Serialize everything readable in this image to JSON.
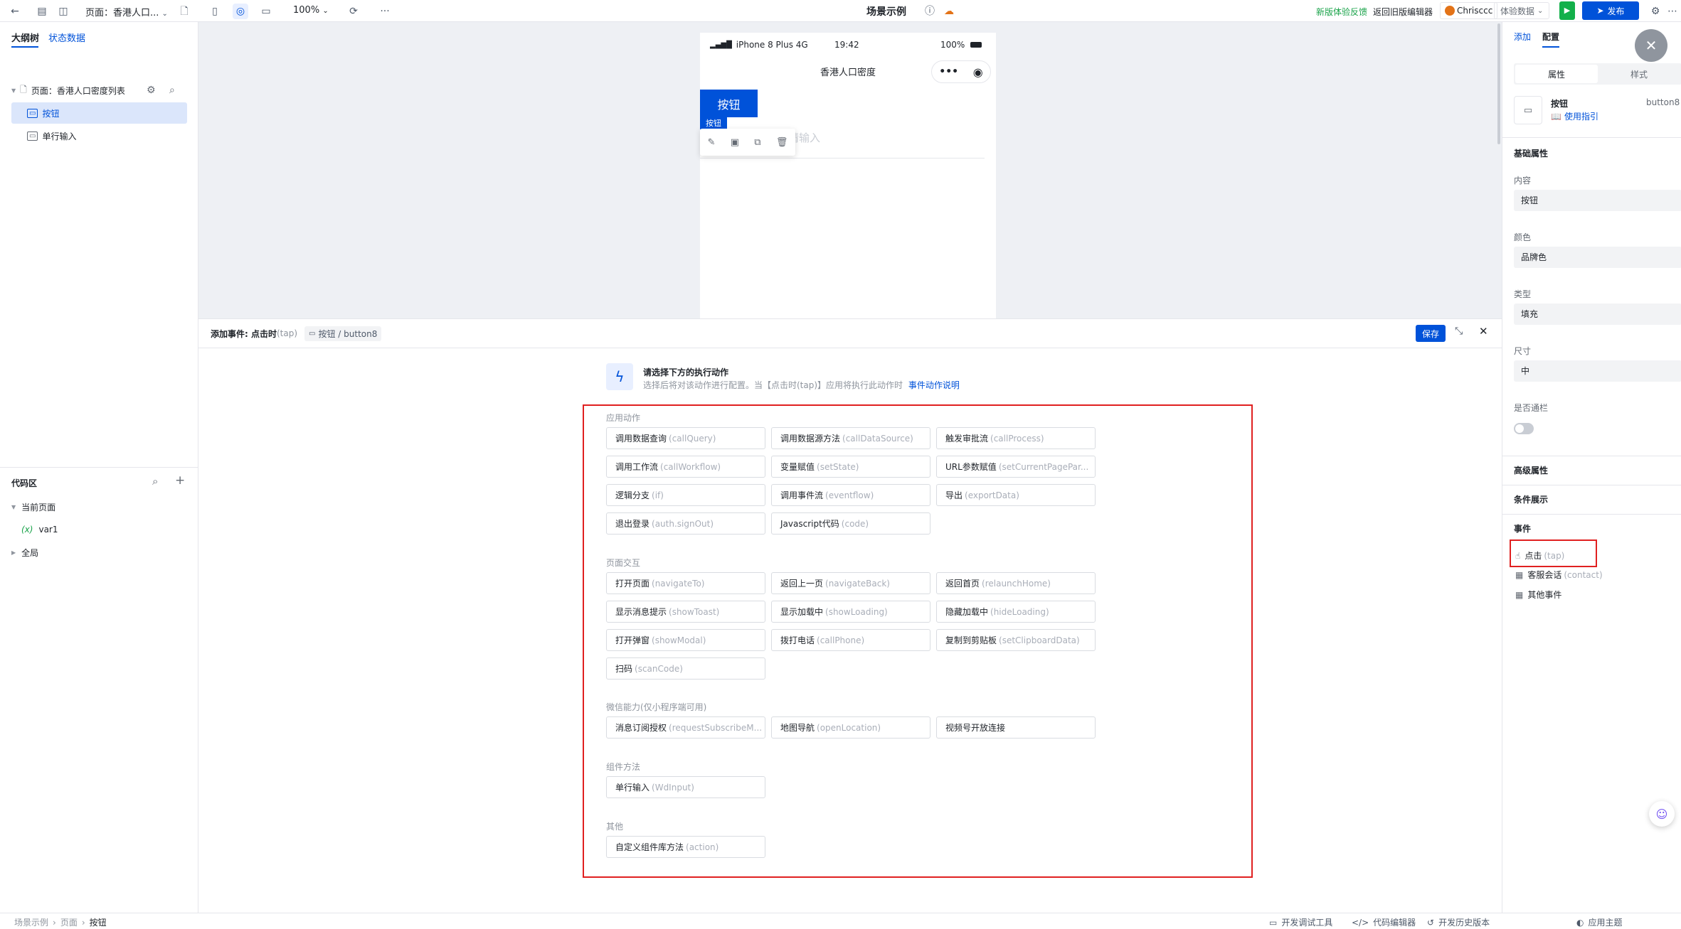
{
  "topbar": {
    "page_select": "页面：香港人口...",
    "zoom": "100%",
    "title": "场景示例",
    "feedback": "新版体验反馈",
    "back_old": "返回旧版编辑器",
    "user": "Chrisccc",
    "env": "体验数据",
    "publish": "发布"
  },
  "left": {
    "tab_outline": "大纲树",
    "tab_state": "状态数据",
    "page_node": "页面：香港人口密度列表",
    "node_button": "按钮",
    "node_input": "单行输入",
    "code_title": "代码区",
    "code_current": "当前页面",
    "code_var": "var1",
    "code_global": "全局"
  },
  "phone": {
    "carrier": "iPhone 8 Plus  4G",
    "time": "19:42",
    "battery": "100%",
    "title": "香港人口密度",
    "button_label": "按钮",
    "selected_tag": "按钮",
    "input_placeholder": "请输入"
  },
  "event": {
    "header_title": "添加事件: 点击时",
    "header_tap": "(tap)",
    "header_target": "按钮 / button8",
    "save": "保存",
    "prompt_title": "请选择下方的执行动作",
    "prompt_desc": "选择后将对该动作进行配置。当【点击时(tap)】应用将执行此动作时",
    "prompt_link": "事件动作说明",
    "sections": [
      {
        "title": "应用动作",
        "items": [
          {
            "cn": "调用数据查询",
            "en": "(callQuery)"
          },
          {
            "cn": "调用数据源方法",
            "en": "(callDataSource)"
          },
          {
            "cn": "触发审批流",
            "en": "(callProcess)"
          },
          {
            "cn": "调用工作流",
            "en": "(callWorkflow)"
          },
          {
            "cn": "变量赋值",
            "en": "(setState)"
          },
          {
            "cn": "URL参数赋值",
            "en": "(setCurrentPagePar..."
          },
          {
            "cn": "逻辑分支",
            "en": "(if)"
          },
          {
            "cn": "调用事件流",
            "en": "(eventflow)"
          },
          {
            "cn": "导出",
            "en": "(exportData)"
          },
          {
            "cn": "退出登录",
            "en": "(auth.signOut)"
          },
          {
            "cn": "Javascript代码",
            "en": "(code)"
          }
        ]
      },
      {
        "title": "页面交互",
        "items": [
          {
            "cn": "打开页面",
            "en": "(navigateTo)"
          },
          {
            "cn": "返回上一页",
            "en": "(navigateBack)"
          },
          {
            "cn": "返回首页",
            "en": "(relaunchHome)"
          },
          {
            "cn": "显示消息提示",
            "en": "(showToast)"
          },
          {
            "cn": "显示加载中",
            "en": "(showLoading)"
          },
          {
            "cn": "隐藏加载中",
            "en": "(hideLoading)"
          },
          {
            "cn": "打开弹窗",
            "en": "(showModal)"
          },
          {
            "cn": "拨打电话",
            "en": "(callPhone)"
          },
          {
            "cn": "复制到剪贴板",
            "en": "(setClipboardData)"
          },
          {
            "cn": "扫码",
            "en": "(scanCode)"
          }
        ]
      },
      {
        "title": "微信能力(仅小程序端可用)",
        "items": [
          {
            "cn": "消息订阅授权",
            "en": "(requestSubscribeM..."
          },
          {
            "cn": "地图导航",
            "en": "(openLocation)"
          },
          {
            "cn": "视频号开放连接",
            "en": ""
          }
        ]
      },
      {
        "title": "组件方法",
        "items": [
          {
            "cn": "单行输入",
            "en": "(WdInput)"
          }
        ]
      },
      {
        "title": "其他",
        "items": [
          {
            "cn": "自定义组件库方法",
            "en": "(action)"
          }
        ]
      }
    ]
  },
  "right": {
    "tab_add": "添加",
    "tab_config": "配置",
    "seg_attr": "属性",
    "seg_style": "样式",
    "comp_name": "按钮",
    "comp_id": "button8",
    "comp_guide": "使用指引",
    "basic": "基础属性",
    "content_label": "内容",
    "content_value": "按钮",
    "color_label": "颜色",
    "color_value": "品牌色",
    "type_label": "类型",
    "type_value": "填充",
    "size_label": "尺寸",
    "size_value": "中",
    "transparent_label": "是否通栏",
    "advanced": "高级属性",
    "condition": "条件展示",
    "events": "事件",
    "ev_tap_cn": "点击",
    "ev_tap_en": "(tap)",
    "ev_contact_cn": "客服会话",
    "ev_contact_en": "(contact)",
    "ev_other": "其他事件"
  },
  "status": {
    "crumb1": "场景示例",
    "crumb2": "页面",
    "crumb3": "按钮",
    "debug": "开发调试工具",
    "code_editor": "代码编辑器",
    "history": "开发历史版本",
    "theme": "应用主题"
  },
  "colors": {
    "brand": "#0052d9",
    "highlight_border": "#e02020",
    "feedback_green": "#1aa34a",
    "run_green": "#13b04a"
  }
}
